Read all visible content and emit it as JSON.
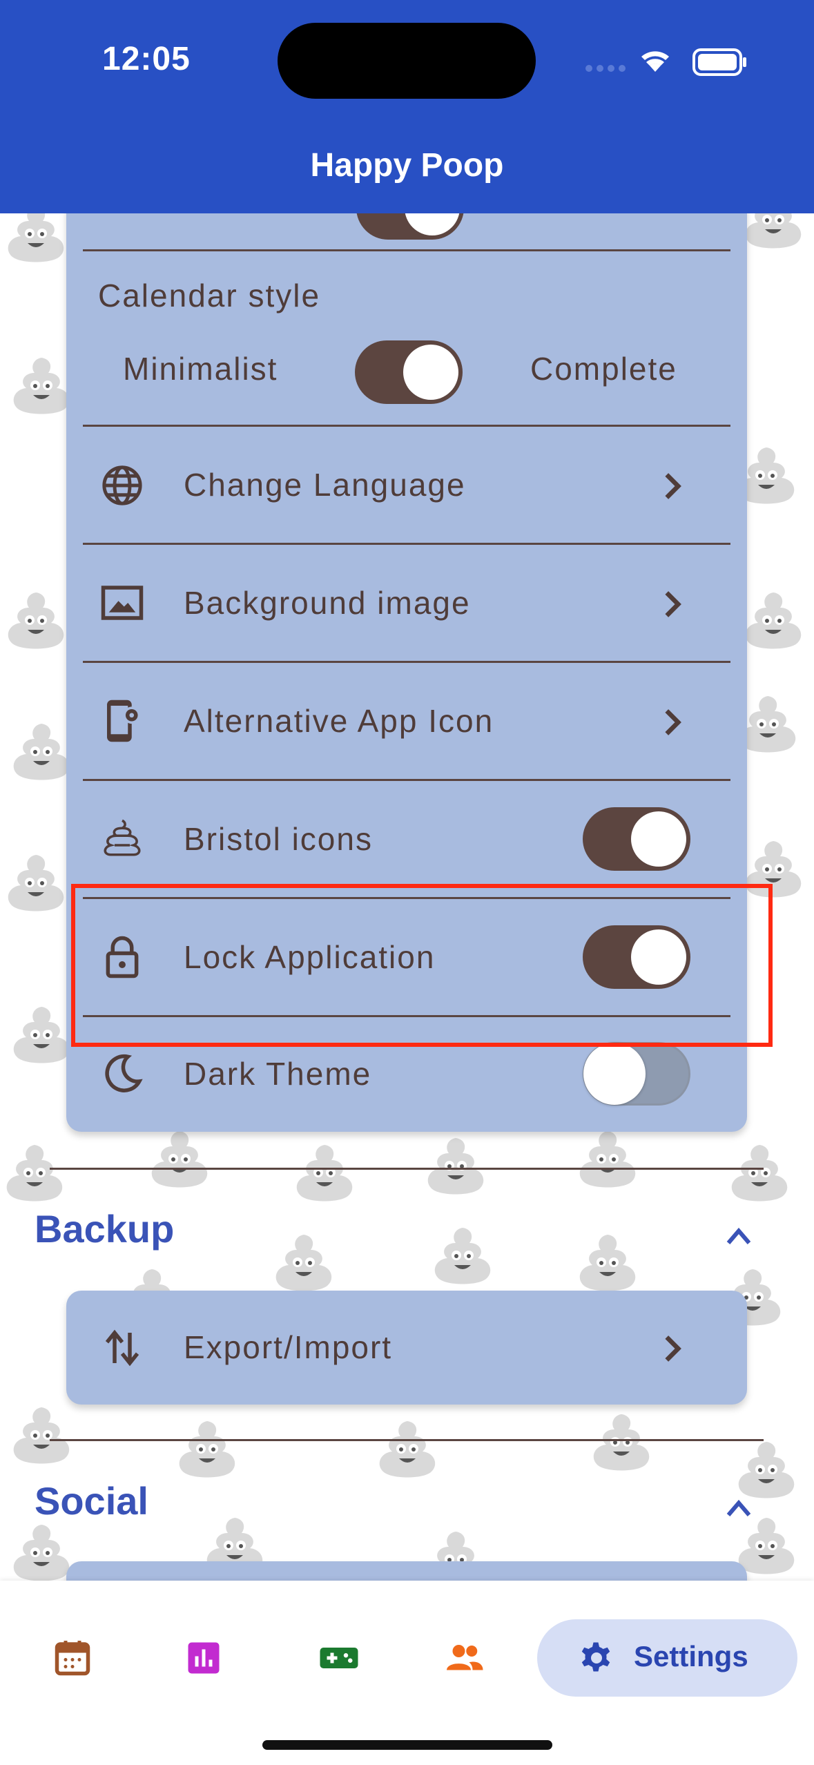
{
  "status_bar": {
    "time": "12:05"
  },
  "header": {
    "title": "Happy Poop"
  },
  "appearance_card": {
    "calendar_style": {
      "title": "Calendar style",
      "left_option": "Minimalist",
      "right_option": "Complete",
      "toggle_on": true
    },
    "rows": [
      {
        "label": "Change Language",
        "icon": "globe-icon",
        "control": "chevron"
      },
      {
        "label": "Background image",
        "icon": "image-icon",
        "control": "chevron"
      },
      {
        "label": "Alternative App Icon",
        "icon": "phone-settings-icon",
        "control": "chevron"
      },
      {
        "label": "Bristol icons",
        "icon": "poop-outline-icon",
        "control": "toggle",
        "on": true
      },
      {
        "label": "Lock Application",
        "icon": "lock-icon",
        "control": "toggle",
        "on": true,
        "highlighted": true
      },
      {
        "label": "Dark Theme",
        "icon": "moon-icon",
        "control": "toggle",
        "on": false
      }
    ]
  },
  "sections": [
    {
      "title": "Backup",
      "expanded": true,
      "rows": [
        {
          "label": "Export/Import",
          "icon": "swap-vertical-icon"
        }
      ]
    },
    {
      "title": "Social",
      "expanded": true
    }
  ],
  "bottom_nav": {
    "items": [
      {
        "name": "calendar-icon",
        "color": "#a0552a"
      },
      {
        "name": "stats-icon",
        "color": "#c22bd0"
      },
      {
        "name": "gamepad-icon",
        "color": "#1b7a2f"
      },
      {
        "name": "people-icon",
        "color": "#f06a1a"
      },
      {
        "name": "gear-icon",
        "color": "#2a45b0",
        "label": "Settings",
        "active": true
      }
    ]
  },
  "colors": {
    "header": "#2850c4",
    "card": "#a8bbdf",
    "text": "#4f3c39",
    "section_title": "#3a53b7",
    "toggle_on": "#5c4540",
    "highlight": "#ff2a12"
  }
}
